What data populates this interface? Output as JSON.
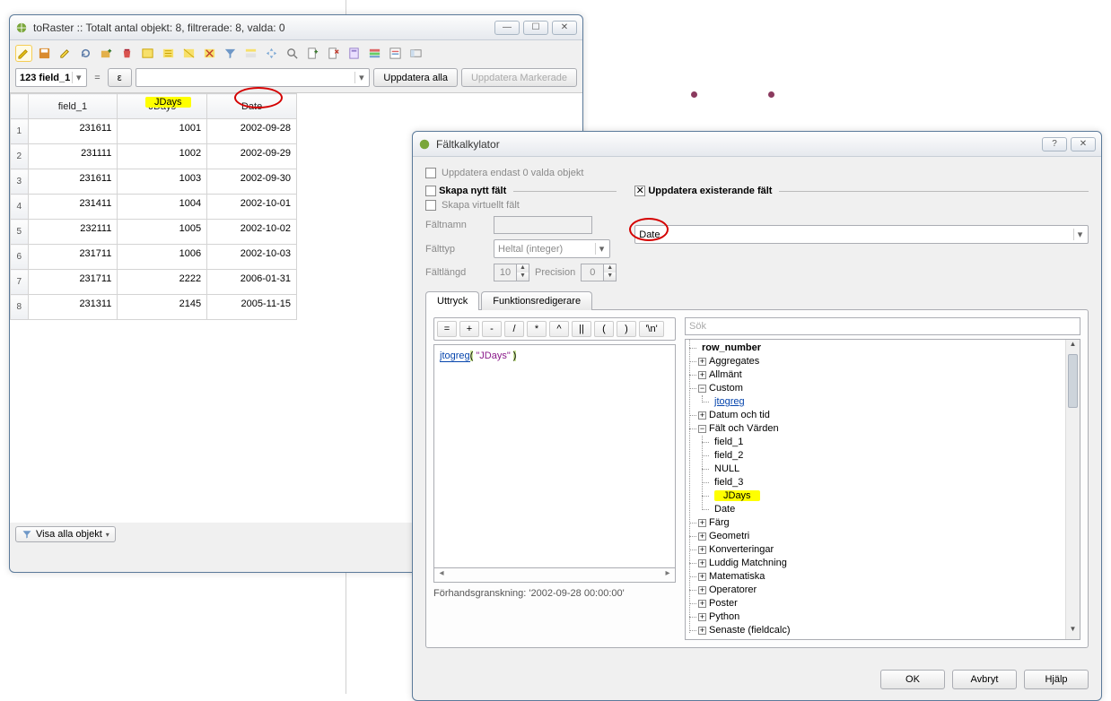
{
  "attr_window": {
    "title": "toRaster :: Totalt antal objekt: 8, filtrerade: 8, valda: 0",
    "field_combo": "123 field_1",
    "expr_value": "",
    "update_all": "Uppdatera alla",
    "update_selected": "Uppdatera Markerade",
    "columns": [
      "field_1",
      "JDays",
      "Date"
    ],
    "rows": [
      [
        "231611",
        "1001",
        "2002-09-28"
      ],
      [
        "231111",
        "1002",
        "2002-09-29"
      ],
      [
        "231611",
        "1003",
        "2002-09-30"
      ],
      [
        "231411",
        "1004",
        "2002-10-01"
      ],
      [
        "232111",
        "1005",
        "2002-10-02"
      ],
      [
        "231711",
        "1006",
        "2002-10-03"
      ],
      [
        "231711",
        "2222",
        "2006-01-31"
      ],
      [
        "231311",
        "2145",
        "2005-11-15"
      ]
    ],
    "status_button": "Visa alla objekt"
  },
  "calc_window": {
    "title": "Fältkalkylator",
    "update_selected_only": "Uppdatera endast 0 valda objekt",
    "create_new": "Skapa nytt fält",
    "update_existing": "Uppdatera existerande fält",
    "create_virtual": "Skapa virtuellt fält",
    "fieldname_label": "Fältnamn",
    "fieldtype_label": "Fälttyp",
    "fieldtype_value": "Heltal (integer)",
    "fieldlen_label": "Fältlängd",
    "fieldlen_value": "10",
    "precision_label": "Precision",
    "precision_value": "0",
    "target_field": "Date",
    "tab_expr": "Uttryck",
    "tab_func": "Funktionsredigerare",
    "ops": [
      "=",
      "+",
      "-",
      "/",
      "*",
      "^",
      "||",
      "(",
      ")",
      "'\\n'"
    ],
    "expression_parts": {
      "fn": "jtogreg",
      "p1": "(",
      "arg": " \"JDays\" ",
      "p2": ")"
    },
    "search_placeholder": "Sök",
    "tree": {
      "row_number": "row_number",
      "aggregates": "Aggregates",
      "general": "Allmänt",
      "custom": "Custom",
      "jtogreg": "jtogreg",
      "datetime": "Datum och tid",
      "fields": "Fält och Värden",
      "f1": "field_1",
      "f2": "field_2",
      "null": "NULL",
      "f3": "field_3",
      "jd": "JDays",
      "date": "Date",
      "color": "Färg",
      "geom": "Geometri",
      "conv": "Konverteringar",
      "fuzzy": "Luddig Matchning",
      "math": "Matematiska",
      "oper": "Operatorer",
      "post": "Poster",
      "python": "Python",
      "recent": "Senaste (fieldcalc)"
    },
    "preview": "Förhandsgranskning:  '2002-09-28 00:00:00'",
    "ok": "OK",
    "cancel": "Avbryt",
    "help": "Hjälp"
  }
}
